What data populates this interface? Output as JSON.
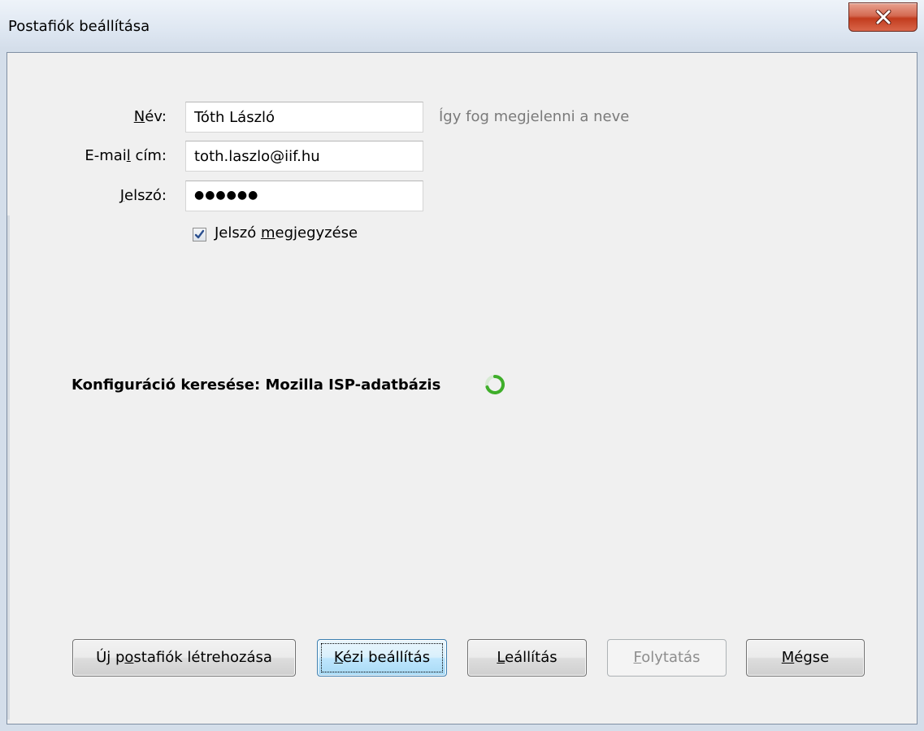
{
  "window": {
    "title": "Postafiók beállítása"
  },
  "form": {
    "name_label_pre": "",
    "name_label_u": "N",
    "name_label_post": "év:",
    "name_value": "Tóth László",
    "name_hint": "Így fog megjelenni a neve",
    "email_label_pre": "E-mai",
    "email_label_u": "l",
    "email_label_post": " cím:",
    "email_value": "toth.laszlo@iif.hu",
    "password_label_pre": "",
    "password_label_u": "J",
    "password_label_post": "elszó:",
    "password_value": "●●●●●●",
    "remember_label_pre": "Jelszó ",
    "remember_label_u": "m",
    "remember_label_post": "egjegyzése",
    "remember_checked": true
  },
  "status": {
    "text": "Konfiguráció keresése: Mozilla ISP-adatbázis"
  },
  "buttons": {
    "new_account_pre": "Új p",
    "new_account_u": "o",
    "new_account_post": "stafiók létrehozása",
    "manual_pre": "",
    "manual_u": "K",
    "manual_post": "ézi beállítás",
    "stop_pre": "",
    "stop_u": "L",
    "stop_post": "eállítás",
    "continue_pre": "",
    "continue_u": "F",
    "continue_post": "olytatás",
    "cancel_pre": "",
    "cancel_u": "M",
    "cancel_post": "égse"
  },
  "colors": {
    "spinner": "#3fae2a",
    "close_button": "#c23c1e",
    "checkbox_check": "#2b4f8f"
  }
}
